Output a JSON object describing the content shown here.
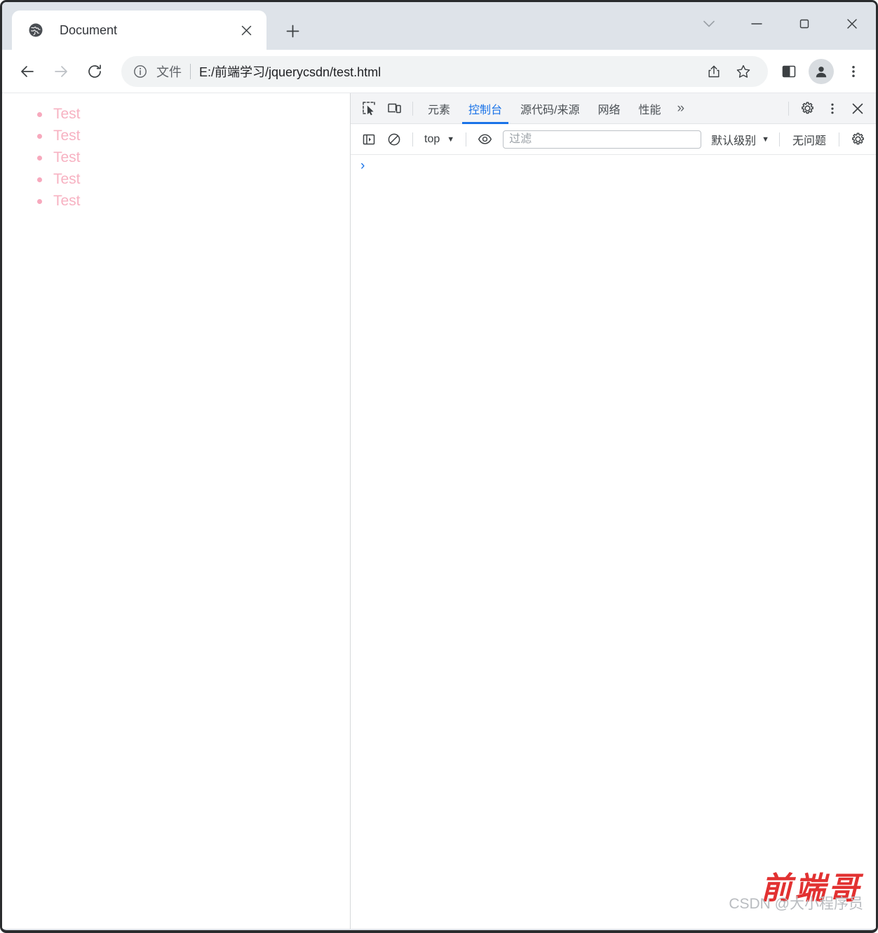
{
  "browser": {
    "tab": {
      "title": "Document",
      "favicon_icon": "globe-icon",
      "close_icon": "close-icon"
    },
    "new_tab_icon": "plus-icon",
    "window_controls": [
      {
        "name": "tab-search-button",
        "icon": "chevron-down-icon",
        "glyph": "⌄"
      },
      {
        "name": "minimize-button",
        "icon": "minimize-icon",
        "glyph": "—"
      },
      {
        "name": "maximize-button",
        "icon": "maximize-icon",
        "glyph": "□"
      },
      {
        "name": "close-window-button",
        "icon": "close-icon",
        "glyph": "✕"
      }
    ],
    "nav": {
      "back_icon": "arrow-left-icon",
      "forward_icon": "arrow-right-icon",
      "reload_icon": "reload-icon"
    },
    "omnibox": {
      "info_icon": "info-circle-icon",
      "scheme_label": "文件",
      "url": "E:/前端学习/jquerycsdn/test.html",
      "share_icon": "share-icon",
      "bookmark_icon": "star-icon"
    },
    "toolbar_actions": [
      {
        "name": "side-panel-button",
        "icon": "side-panel-icon"
      },
      {
        "name": "profile-button",
        "icon": "person-icon"
      },
      {
        "name": "chrome-menu-button",
        "icon": "three-dots-vertical-icon"
      }
    ]
  },
  "page": {
    "list_items": [
      "Test",
      "Test",
      "Test",
      "Test",
      "Test"
    ],
    "text_color": "#f7b2c2",
    "bullet_color": "#f7a9bd"
  },
  "devtools": {
    "header": {
      "inspect_icon": "inspect-element-icon",
      "device_icon": "device-toolbar-icon",
      "tabs": [
        {
          "label": "元素",
          "active": false
        },
        {
          "label": "控制台",
          "active": true
        },
        {
          "label": "源代码/来源",
          "active": false
        },
        {
          "label": "网络",
          "active": false
        },
        {
          "label": "性能",
          "active": false
        }
      ],
      "more_tabs_glyph": "»",
      "settings_icon": "gear-icon",
      "menu_icon": "three-dots-vertical-icon",
      "close_icon": "close-icon",
      "active_color": "#1a73e8"
    },
    "console_toolbar": {
      "sidebar_toggle_icon": "console-sidebar-icon",
      "clear_icon": "clear-console-icon",
      "context_label": "top",
      "context_caret": "▼",
      "eye_icon": "eye-icon",
      "filter_placeholder": "过滤",
      "filter_value": "",
      "level_label": "默认级别",
      "level_caret": "▼",
      "issues_label": "无问题",
      "settings_icon": "gear-icon"
    },
    "console": {
      "prompt_glyph": "›",
      "input_value": "",
      "messages": []
    }
  },
  "watermark": {
    "chinese": "前端哥",
    "latin": "CSDN @大小程序员",
    "color": "#e02020"
  }
}
